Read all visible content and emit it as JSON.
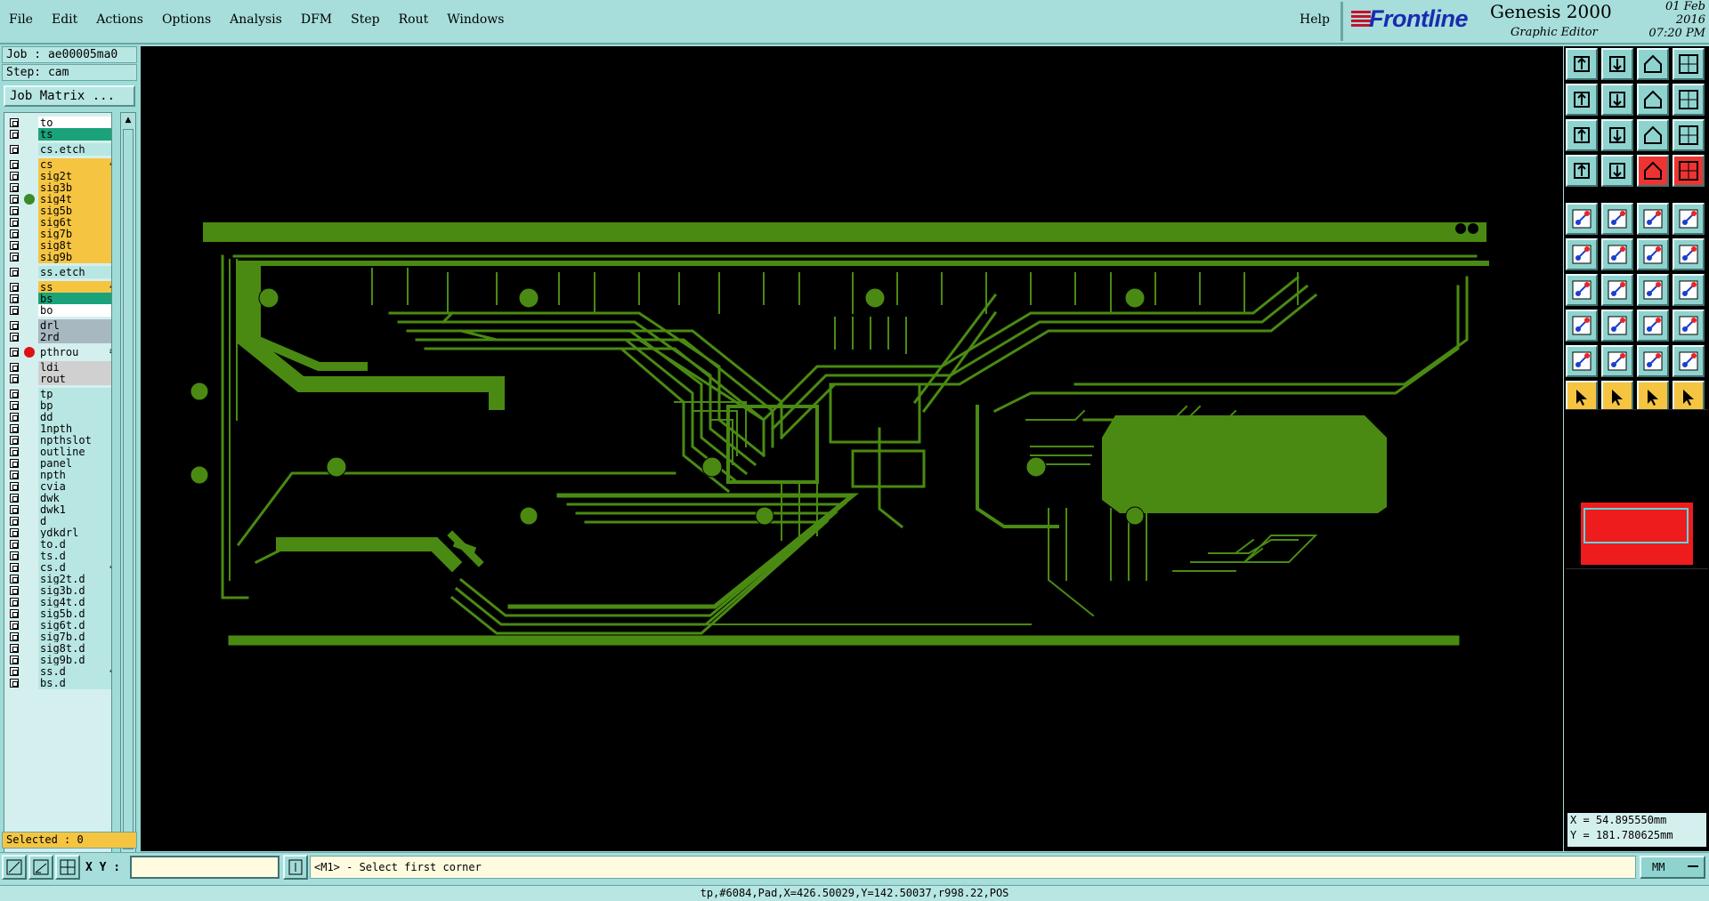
{
  "menu": {
    "items": [
      "File",
      "Edit",
      "Actions",
      "Options",
      "Analysis",
      "DFM",
      "Step",
      "Rout",
      "Windows"
    ],
    "help": "Help"
  },
  "brand": {
    "logo": "Frontline",
    "product": "Genesis 2000",
    "subtitle": "Graphic Editor",
    "date": "01 Feb 2016",
    "time": "07:20 PM"
  },
  "job": {
    "job_line": "Job : ae00005ma0",
    "step_line": "Step: cam",
    "matrix_button": "Job Matrix ..."
  },
  "layers": [
    {
      "name": "to",
      "color": "#ffffff"
    },
    {
      "name": "ts",
      "color": "#1aa37a"
    },
    {
      "name": "cs.etch",
      "color": "#b8e6e3"
    },
    {
      "name": "cs",
      "color": "#f5c542",
      "mark": "✐"
    },
    {
      "name": "sig2t",
      "color": "#f5c542"
    },
    {
      "name": "sig3b",
      "color": "#f5c542"
    },
    {
      "name": "sig4t",
      "color": "#f5c542",
      "dot": "#3a8a2a"
    },
    {
      "name": "sig5b",
      "color": "#f5c542"
    },
    {
      "name": "sig6t",
      "color": "#f5c542"
    },
    {
      "name": "sig7b",
      "color": "#f5c542"
    },
    {
      "name": "sig8t",
      "color": "#f5c542"
    },
    {
      "name": "sig9b",
      "color": "#f5c542"
    },
    {
      "name": "ss.etch",
      "color": "#b8e6e3"
    },
    {
      "name": "ss",
      "color": "#f5c542",
      "mark": "✐"
    },
    {
      "name": "bs",
      "color": "#1aa37a"
    },
    {
      "name": "bo",
      "color": "#ffffff"
    },
    {
      "name": "drl",
      "color": "#a8b8c0"
    },
    {
      "name": "2rd",
      "color": "#a8b8c0"
    },
    {
      "name": "pthrou",
      "color": "#d4f0ee",
      "dot": "#dd1111",
      "mark": "≡"
    },
    {
      "name": "ldi",
      "color": "#d0d0d0"
    },
    {
      "name": "rout",
      "color": "#d0d0d0"
    },
    {
      "name": "tp",
      "color": "#b8e6e3"
    },
    {
      "name": "bp",
      "color": "#b8e6e3"
    },
    {
      "name": "dd",
      "color": "#b8e6e3"
    },
    {
      "name": "1npth",
      "color": "#b8e6e3"
    },
    {
      "name": "npthslot",
      "color": "#b8e6e3"
    },
    {
      "name": "outline",
      "color": "#b8e6e3"
    },
    {
      "name": "panel",
      "color": "#b8e6e3"
    },
    {
      "name": "npth",
      "color": "#b8e6e3"
    },
    {
      "name": "cvia",
      "color": "#b8e6e3"
    },
    {
      "name": "dwk",
      "color": "#b8e6e3"
    },
    {
      "name": "dwk1",
      "color": "#b8e6e3"
    },
    {
      "name": "d",
      "color": "#b8e6e3"
    },
    {
      "name": "ydkdrl",
      "color": "#b8e6e3"
    },
    {
      "name": "to.d",
      "color": "#b8e6e3"
    },
    {
      "name": "ts.d",
      "color": "#b8e6e3"
    },
    {
      "name": "cs.d",
      "color": "#b8e6e3",
      "mark": "✐"
    },
    {
      "name": "sig2t.d",
      "color": "#b8e6e3"
    },
    {
      "name": "sig3b.d",
      "color": "#b8e6e3"
    },
    {
      "name": "sig4t.d",
      "color": "#b8e6e3"
    },
    {
      "name": "sig5b.d",
      "color": "#b8e6e3"
    },
    {
      "name": "sig6t.d",
      "color": "#b8e6e3"
    },
    {
      "name": "sig7b.d",
      "color": "#b8e6e3"
    },
    {
      "name": "sig8t.d",
      "color": "#b8e6e3"
    },
    {
      "name": "sig9b.d",
      "color": "#b8e6e3"
    },
    {
      "name": "ss.d",
      "color": "#b8e6e3",
      "mark": "✐"
    },
    {
      "name": "bs.d",
      "color": "#b8e6e3"
    }
  ],
  "selected": "Selected : 0",
  "coords": {
    "x": "X = 54.895550mm",
    "y": "Y = 181.780625mm"
  },
  "bottom": {
    "xy_label": "X Y :",
    "xy_value": "",
    "prompt": "<M1> - Select first corner",
    "units": "MM"
  },
  "status": "tp,#6084,Pad,X=426.50029,Y=142.50037,r998.22,POS",
  "colors": {
    "copper": "#4a8a12",
    "canvas": "#000000",
    "panel_bg": "#9fdcd8"
  },
  "tools": [
    "zoom-home-icon",
    "zoom-out-icon",
    "home-icon",
    "window-icon",
    "pan-left-icon",
    "pan-right-icon",
    "zoom-back-icon",
    "redraw-icon",
    "fit-screen-icon",
    "zoom-center-icon",
    "scale-1-2-icon",
    "help-icon",
    "measure-icon",
    "pad-icon",
    "net-highlight-icon",
    "net-compare-icon",
    "snap-pad-icon",
    "snap-shape-icon",
    "snap-line-icon",
    "snap-circle-icon",
    "add-node-icon",
    "delete-node-icon",
    "move-point-icon",
    "connect-icon",
    "angle-line-icon",
    "diagonal-line-icon",
    "arc-icon",
    "split-icon",
    "copy-feature-icon",
    "cut-line-icon",
    "slot-icon",
    "pattern-icon",
    "fillet-icon",
    "triangle-icon",
    "arch-icon",
    "arch-cut-icon",
    "select-icon",
    "select-single-icon",
    "select-polygon-icon",
    "select-multi-icon"
  ]
}
